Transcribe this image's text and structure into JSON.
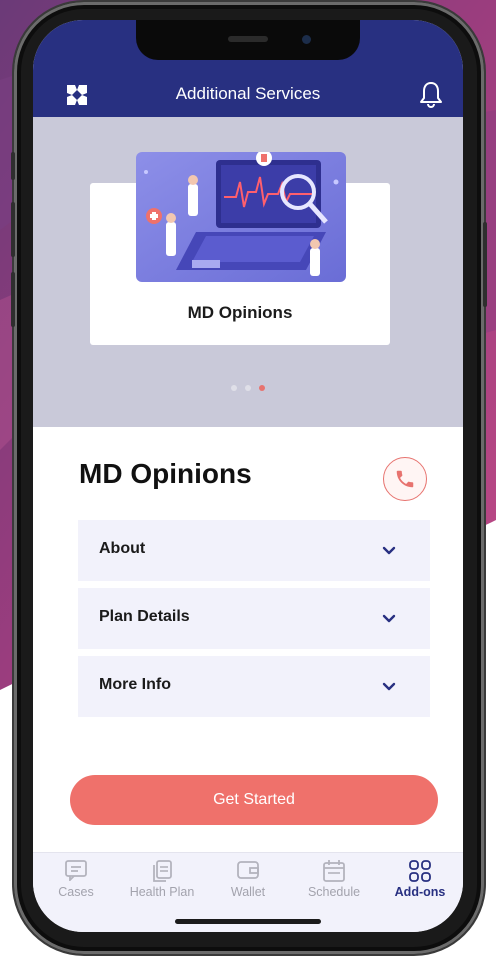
{
  "header": {
    "title": "Additional Services",
    "logo_icon": "app-logo-icon",
    "bell_icon": "bell-icon"
  },
  "carousel": {
    "card_title": "MD Opinions",
    "slide_count": 3,
    "active_slide_index": 2
  },
  "main": {
    "title": "MD Opinions",
    "call_icon": "phone-icon",
    "accordion": [
      {
        "label": "About"
      },
      {
        "label": "Plan Details"
      },
      {
        "label": "More Info"
      }
    ],
    "cta_label": "Get Started"
  },
  "tabbar": {
    "tabs": [
      {
        "label": "Cases",
        "icon": "message-icon"
      },
      {
        "label": "Health Plan",
        "icon": "documents-icon"
      },
      {
        "label": "Wallet",
        "icon": "wallet-icon"
      },
      {
        "label": "Schedule",
        "icon": "calendar-icon"
      },
      {
        "label": "Add-ons",
        "icon": "grid-icon"
      }
    ],
    "active_tab": "Add-ons"
  },
  "colors": {
    "header": "#283081",
    "accent": "#ef716b",
    "carousel_bg": "#c9c9d9",
    "accordion_bg": "#f2f2fb"
  }
}
